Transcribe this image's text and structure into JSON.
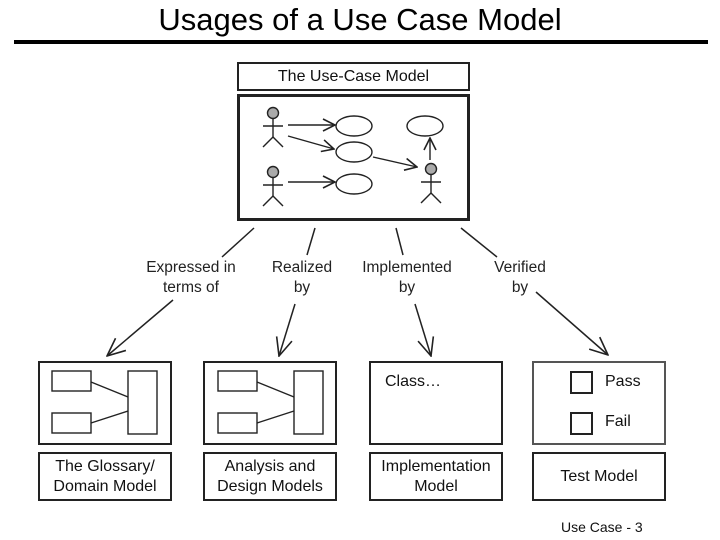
{
  "slide": {
    "title": "Usages of a Use Case Model",
    "footer": "Use Case - 3"
  },
  "use_case_model": {
    "label": "The Use-Case Model",
    "actors": [
      "actor-1",
      "actor-2",
      "actor-3"
    ],
    "use_cases": [
      "use-case-1",
      "use-case-2",
      "use-case-3",
      "use-case-4"
    ]
  },
  "relations": [
    {
      "label": "Expressed in\nterms of"
    },
    {
      "label": "Realized\nby"
    },
    {
      "label": "Implemented\nby"
    },
    {
      "label": "Verified\nby"
    }
  ],
  "targets": [
    {
      "label": "The Glossary/\nDomain Model"
    },
    {
      "label": "Analysis and\nDesign Models"
    },
    {
      "label": "Implementation\nModel",
      "content_text": "Class…"
    },
    {
      "label": "Test Model",
      "checkboxes": [
        "Pass",
        "Fail"
      ]
    }
  ]
}
